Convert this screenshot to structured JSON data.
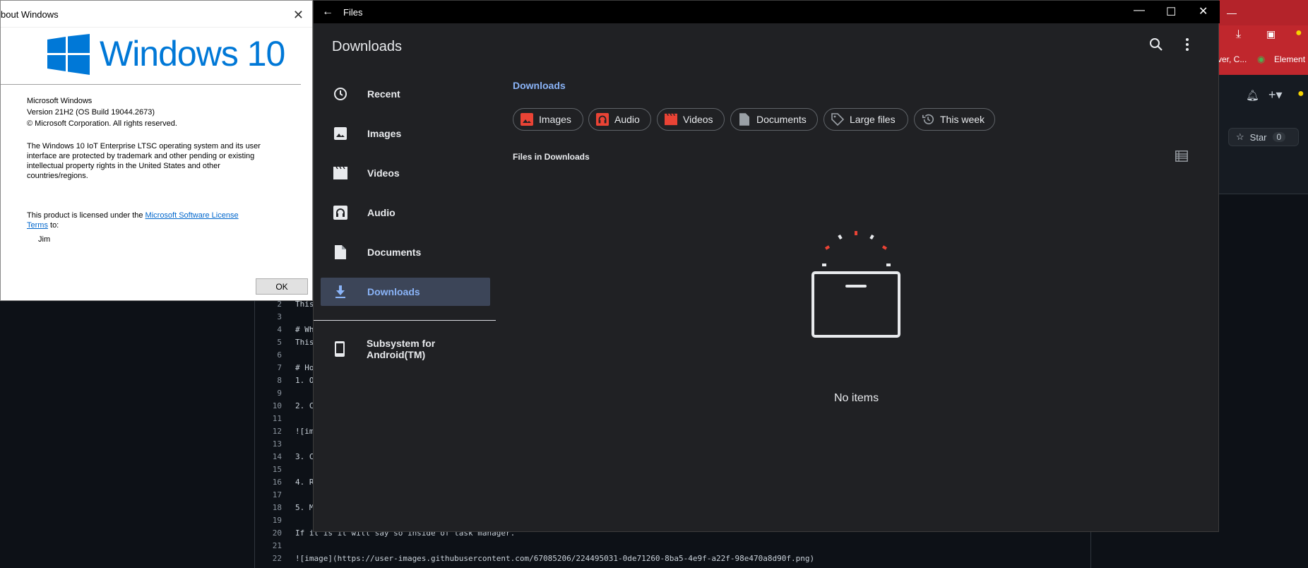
{
  "about": {
    "title": "bout Windows",
    "logo_text": "Windows 10",
    "product": "Microsoft Windows",
    "version": "Version 21H2 (OS Build 19044.2673)",
    "copyright": "© Microsoft Corporation. All rights reserved.",
    "desc_l1": "The Windows 10 IoT Enterprise LTSC operating system and its user",
    "desc_l2": "interface are protected by trademark and other pending or existing",
    "desc_l3": "intellectual property rights in the United States and other",
    "desc_l4": "countries/regions.",
    "license_prefix": "This product is licensed under the ",
    "license_link_1": "Microsoft Software License",
    "license_link_2": "Terms",
    "license_suffix": " to:",
    "licensee": "Jim",
    "ok_label": "OK"
  },
  "files": {
    "window_title": "Files",
    "header": "Downloads",
    "nav": [
      {
        "label": "Recent",
        "icon": "clock-icon"
      },
      {
        "label": "Images",
        "icon": "image-icon"
      },
      {
        "label": "Videos",
        "icon": "video-icon"
      },
      {
        "label": "Audio",
        "icon": "headphones-icon"
      },
      {
        "label": "Documents",
        "icon": "document-icon"
      },
      {
        "label": "Downloads",
        "icon": "download-icon"
      },
      {
        "label": "Subsystem for Android(TM)",
        "icon": "phone-icon"
      }
    ],
    "breadcrumb": "Downloads",
    "chips": [
      {
        "label": "Images",
        "icon": "image-icon"
      },
      {
        "label": "Audio",
        "icon": "headphones-icon"
      },
      {
        "label": "Videos",
        "icon": "video-icon"
      },
      {
        "label": "Documents",
        "icon": "document-icon"
      },
      {
        "label": "Large files",
        "icon": "tag-icon"
      },
      {
        "label": "This week",
        "icon": "history-icon"
      }
    ],
    "section_label": "Files in Downloads",
    "empty_text": "No items"
  },
  "background": {
    "bookmarks_text": "ver, C...",
    "element_label": "Element",
    "star_label": "Star",
    "star_count": "0",
    "code_lines": [
      {
        "n": "2",
        "t": "This"
      },
      {
        "n": "3",
        "t": ""
      },
      {
        "n": "4",
        "t": "# Wh"
      },
      {
        "n": "5",
        "t": "This"
      },
      {
        "n": "6",
        "t": ""
      },
      {
        "n": "7",
        "t": "# Ho"
      },
      {
        "n": "8",
        "t": "1. O"
      },
      {
        "n": "9",
        "t": ""
      },
      {
        "n": "10",
        "t": "2. C"
      },
      {
        "n": "11",
        "t": ""
      },
      {
        "n": "12",
        "t": "![im"
      },
      {
        "n": "13",
        "t": ""
      },
      {
        "n": "14",
        "t": "3. C"
      },
      {
        "n": "15",
        "t": ""
      },
      {
        "n": "16",
        "t": "4. R"
      },
      {
        "n": "17",
        "t": ""
      },
      {
        "n": "18",
        "t": "5. M"
      },
      {
        "n": "19",
        "t": ""
      },
      {
        "n": "20",
        "t": "If it is it will say so inside of task manager."
      },
      {
        "n": "21",
        "t": ""
      },
      {
        "n": "22",
        "t": "![image](https://user-images.githubusercontent.com/67085206/224495031-0de71260-8ba5-4e9f-a22f-98e470a8d90f.png)"
      }
    ]
  },
  "colors": {
    "accent_blue": "#8ab4f8",
    "files_bg": "#202124",
    "active_nav_bg": "#3c4558",
    "chip_icon_red": "#ea4335",
    "windows_blue": "#0078d7"
  }
}
